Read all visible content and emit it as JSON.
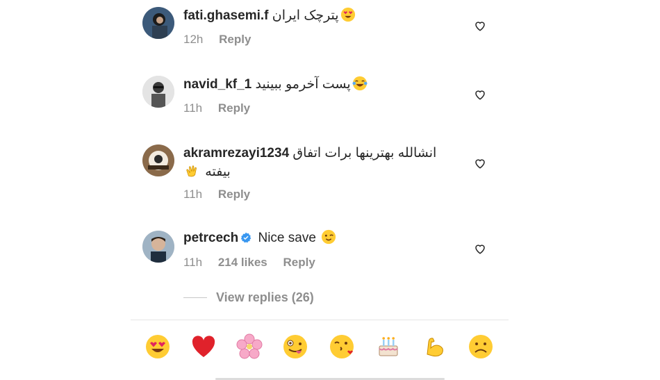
{
  "comments": [
    {
      "username": "fati.ghasemi.f",
      "text": "پترچک ایران",
      "emoji": "heart-eyes",
      "time": "12h",
      "likes": "",
      "reply_label": "Reply"
    },
    {
      "username": "navid_kf_1",
      "text": "پست آخرمو ببینید",
      "emoji": "tears-of-joy",
      "time": "11h",
      "likes": "",
      "reply_label": "Reply"
    },
    {
      "username": "akramrezayi1234",
      "text": "انشالله بهترینها برات اتفاق",
      "text_line2": "بیفته",
      "emoji": "clapping-hands",
      "time": "11h",
      "likes": "",
      "reply_label": "Reply"
    },
    {
      "username": "petrcech",
      "verified": true,
      "text": "Nice save",
      "emoji": "winking-face",
      "time": "11h",
      "likes": "214 likes",
      "reply_label": "Reply"
    }
  ],
  "view_replies": "View replies (26)",
  "emoji_bar": [
    "heart-eyes",
    "red-heart",
    "cherry-blossom",
    "zany-face",
    "face-blowing-kiss",
    "birthday-cake",
    "flexed-biceps",
    "frowning-face"
  ],
  "colors": {
    "text": "#262626",
    "meta": "#8e8e8e",
    "verified": "#3897f0",
    "heart": "#262626"
  }
}
